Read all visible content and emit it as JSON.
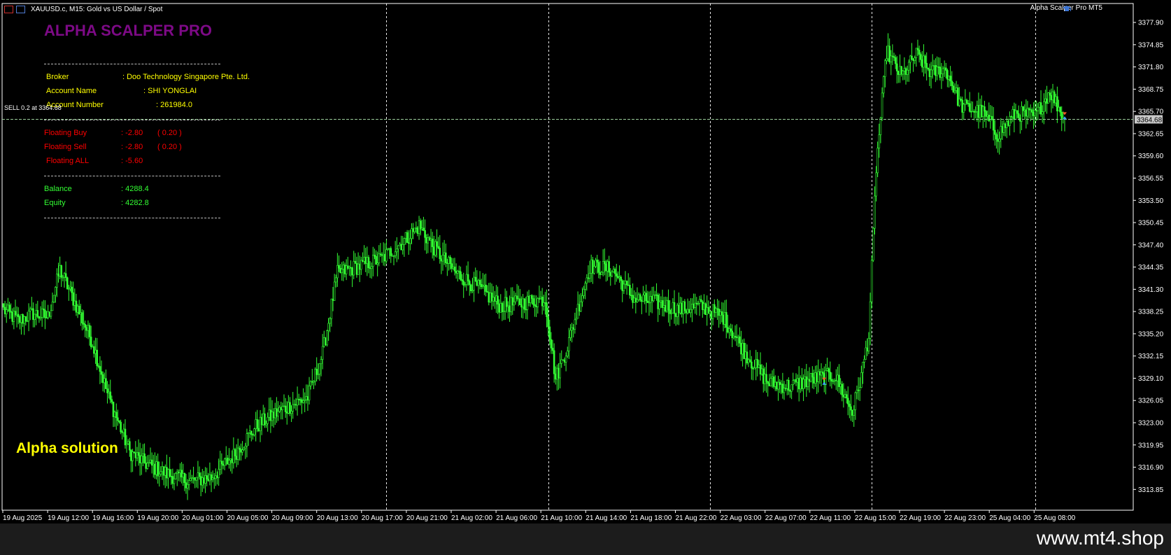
{
  "window": {
    "title": "XAUUSD.c, M15:  Gold vs US Dollar / Spot",
    "ea_name": "Alpha Scalper Pro MT5"
  },
  "panel": {
    "title": "ALPHA SCALPER PRO",
    "broker_label": "Broker",
    "broker_value": ": Doo Technology Singapore Pte. Ltd.",
    "account_name_label": "Account Name",
    "account_name_value": ": SHI YONGLAI",
    "account_number_label": "Account Number",
    "account_number_value": ": 261984.0",
    "floating_buy_label": "Floating Buy",
    "floating_buy_value": ": -2.80",
    "floating_buy_lots": "( 0.20 )",
    "floating_sell_label": "Floating Sell",
    "floating_sell_value": ": -2.80",
    "floating_sell_lots": "( 0.20 )",
    "floating_all_label": "Floating ALL",
    "floating_all_value": ": -5.60",
    "balance_label": "Balance",
    "balance_value": ": 4288.4",
    "equity_label": "Equity",
    "equity_value": ": 4282.8",
    "watermark": "Alpha solution"
  },
  "order_line_label": "SELL 0.2 at 3364.68",
  "site": "www.mt4.shop",
  "colors": {
    "candle": "#33ff33",
    "grid": "#ffffff",
    "bid_line": "#9acd9a",
    "panel_title": "#7d0a86",
    "yellow": "#ffff00",
    "red": "#ff0000"
  },
  "chart_data": {
    "type": "candlestick",
    "symbol": "XAUUSD.c",
    "timeframe": "M15",
    "current_price": 3364.68,
    "ylim": [
      3311.0,
      3380.5
    ],
    "y_ticks": [
      "3377.90",
      "3374.85",
      "3371.80",
      "3368.75",
      "3365.70",
      "3362.65",
      "3359.60",
      "3356.55",
      "3353.50",
      "3350.45",
      "3347.40",
      "3344.35",
      "3341.30",
      "3338.25",
      "3335.20",
      "3332.15",
      "3329.10",
      "3326.05",
      "3323.00",
      "3319.95",
      "3316.90",
      "3313.85"
    ],
    "x_ticks": [
      "19 Aug 2025",
      "19 Aug 12:00",
      "19 Aug 16:00",
      "19 Aug 20:00",
      "20 Aug 01:00",
      "20 Aug 05:00",
      "20 Aug 09:00",
      "20 Aug 13:00",
      "20 Aug 17:00",
      "20 Aug 21:00",
      "21 Aug 02:00",
      "21 Aug 06:00",
      "21 Aug 10:00",
      "21 Aug 14:00",
      "21 Aug 18:00",
      "21 Aug 22:00",
      "22 Aug 03:00",
      "22 Aug 07:00",
      "22 Aug 11:00",
      "22 Aug 15:00",
      "22 Aug 19:00",
      "22 Aug 23:00",
      "25 Aug 04:00",
      "25 Aug 08:00"
    ],
    "period_separators": [
      "20 Aug 00:00",
      "21 Aug 00:00",
      "22 Aug 00:00",
      "23 Aug 00:00",
      "25 Aug 00:00"
    ],
    "close_path": [
      {
        "bar": 0,
        "price": 3338.5
      },
      {
        "bar": 10,
        "price": 3337.0
      },
      {
        "bar": 20,
        "price": 3338.0
      },
      {
        "bar": 30,
        "price": 3337.5
      },
      {
        "bar": 38,
        "price": 3344.0
      },
      {
        "bar": 48,
        "price": 3339.5
      },
      {
        "bar": 60,
        "price": 3334.0
      },
      {
        "bar": 70,
        "price": 3327.0
      },
      {
        "bar": 85,
        "price": 3319.0
      },
      {
        "bar": 95,
        "price": 3317.5
      },
      {
        "bar": 110,
        "price": 3316.0
      },
      {
        "bar": 125,
        "price": 3315.0
      },
      {
        "bar": 140,
        "price": 3315.5
      },
      {
        "bar": 155,
        "price": 3318.5
      },
      {
        "bar": 170,
        "price": 3322.5
      },
      {
        "bar": 185,
        "price": 3324.5
      },
      {
        "bar": 205,
        "price": 3326.5
      },
      {
        "bar": 215,
        "price": 3332.5
      },
      {
        "bar": 225,
        "price": 3343.5
      },
      {
        "bar": 240,
        "price": 3344.5
      },
      {
        "bar": 255,
        "price": 3345.5
      },
      {
        "bar": 270,
        "price": 3348.0
      },
      {
        "bar": 280,
        "price": 3350.0
      },
      {
        "bar": 290,
        "price": 3347.0
      },
      {
        "bar": 305,
        "price": 3343.5
      },
      {
        "bar": 320,
        "price": 3341.5
      },
      {
        "bar": 335,
        "price": 3339.0
      },
      {
        "bar": 350,
        "price": 3339.5
      },
      {
        "bar": 365,
        "price": 3340.0
      },
      {
        "bar": 372,
        "price": 3329.0
      },
      {
        "bar": 380,
        "price": 3333.5
      },
      {
        "bar": 395,
        "price": 3344.5
      },
      {
        "bar": 410,
        "price": 3344.0
      },
      {
        "bar": 425,
        "price": 3340.0
      },
      {
        "bar": 440,
        "price": 3339.5
      },
      {
        "bar": 455,
        "price": 3338.5
      },
      {
        "bar": 470,
        "price": 3339.0
      },
      {
        "bar": 485,
        "price": 3337.5
      },
      {
        "bar": 500,
        "price": 3332.5
      },
      {
        "bar": 515,
        "price": 3328.5
      },
      {
        "bar": 530,
        "price": 3328.0
      },
      {
        "bar": 545,
        "price": 3329.0
      },
      {
        "bar": 560,
        "price": 3329.5
      },
      {
        "bar": 572,
        "price": 3324.5
      },
      {
        "bar": 578,
        "price": 3329.5
      },
      {
        "bar": 583,
        "price": 3335.0
      },
      {
        "bar": 588,
        "price": 3358.0
      },
      {
        "bar": 595,
        "price": 3374.0
      },
      {
        "bar": 605,
        "price": 3370.5
      },
      {
        "bar": 615,
        "price": 3373.5
      },
      {
        "bar": 625,
        "price": 3371.0
      },
      {
        "bar": 635,
        "price": 3371.5
      },
      {
        "bar": 645,
        "price": 3366.5
      },
      {
        "bar": 660,
        "price": 3365.5
      },
      {
        "bar": 670,
        "price": 3362.5
      },
      {
        "bar": 682,
        "price": 3365.5
      },
      {
        "bar": 695,
        "price": 3365.0
      },
      {
        "bar": 705,
        "price": 3368.5
      },
      {
        "bar": 715,
        "price": 3364.7
      }
    ],
    "bars": 716
  }
}
